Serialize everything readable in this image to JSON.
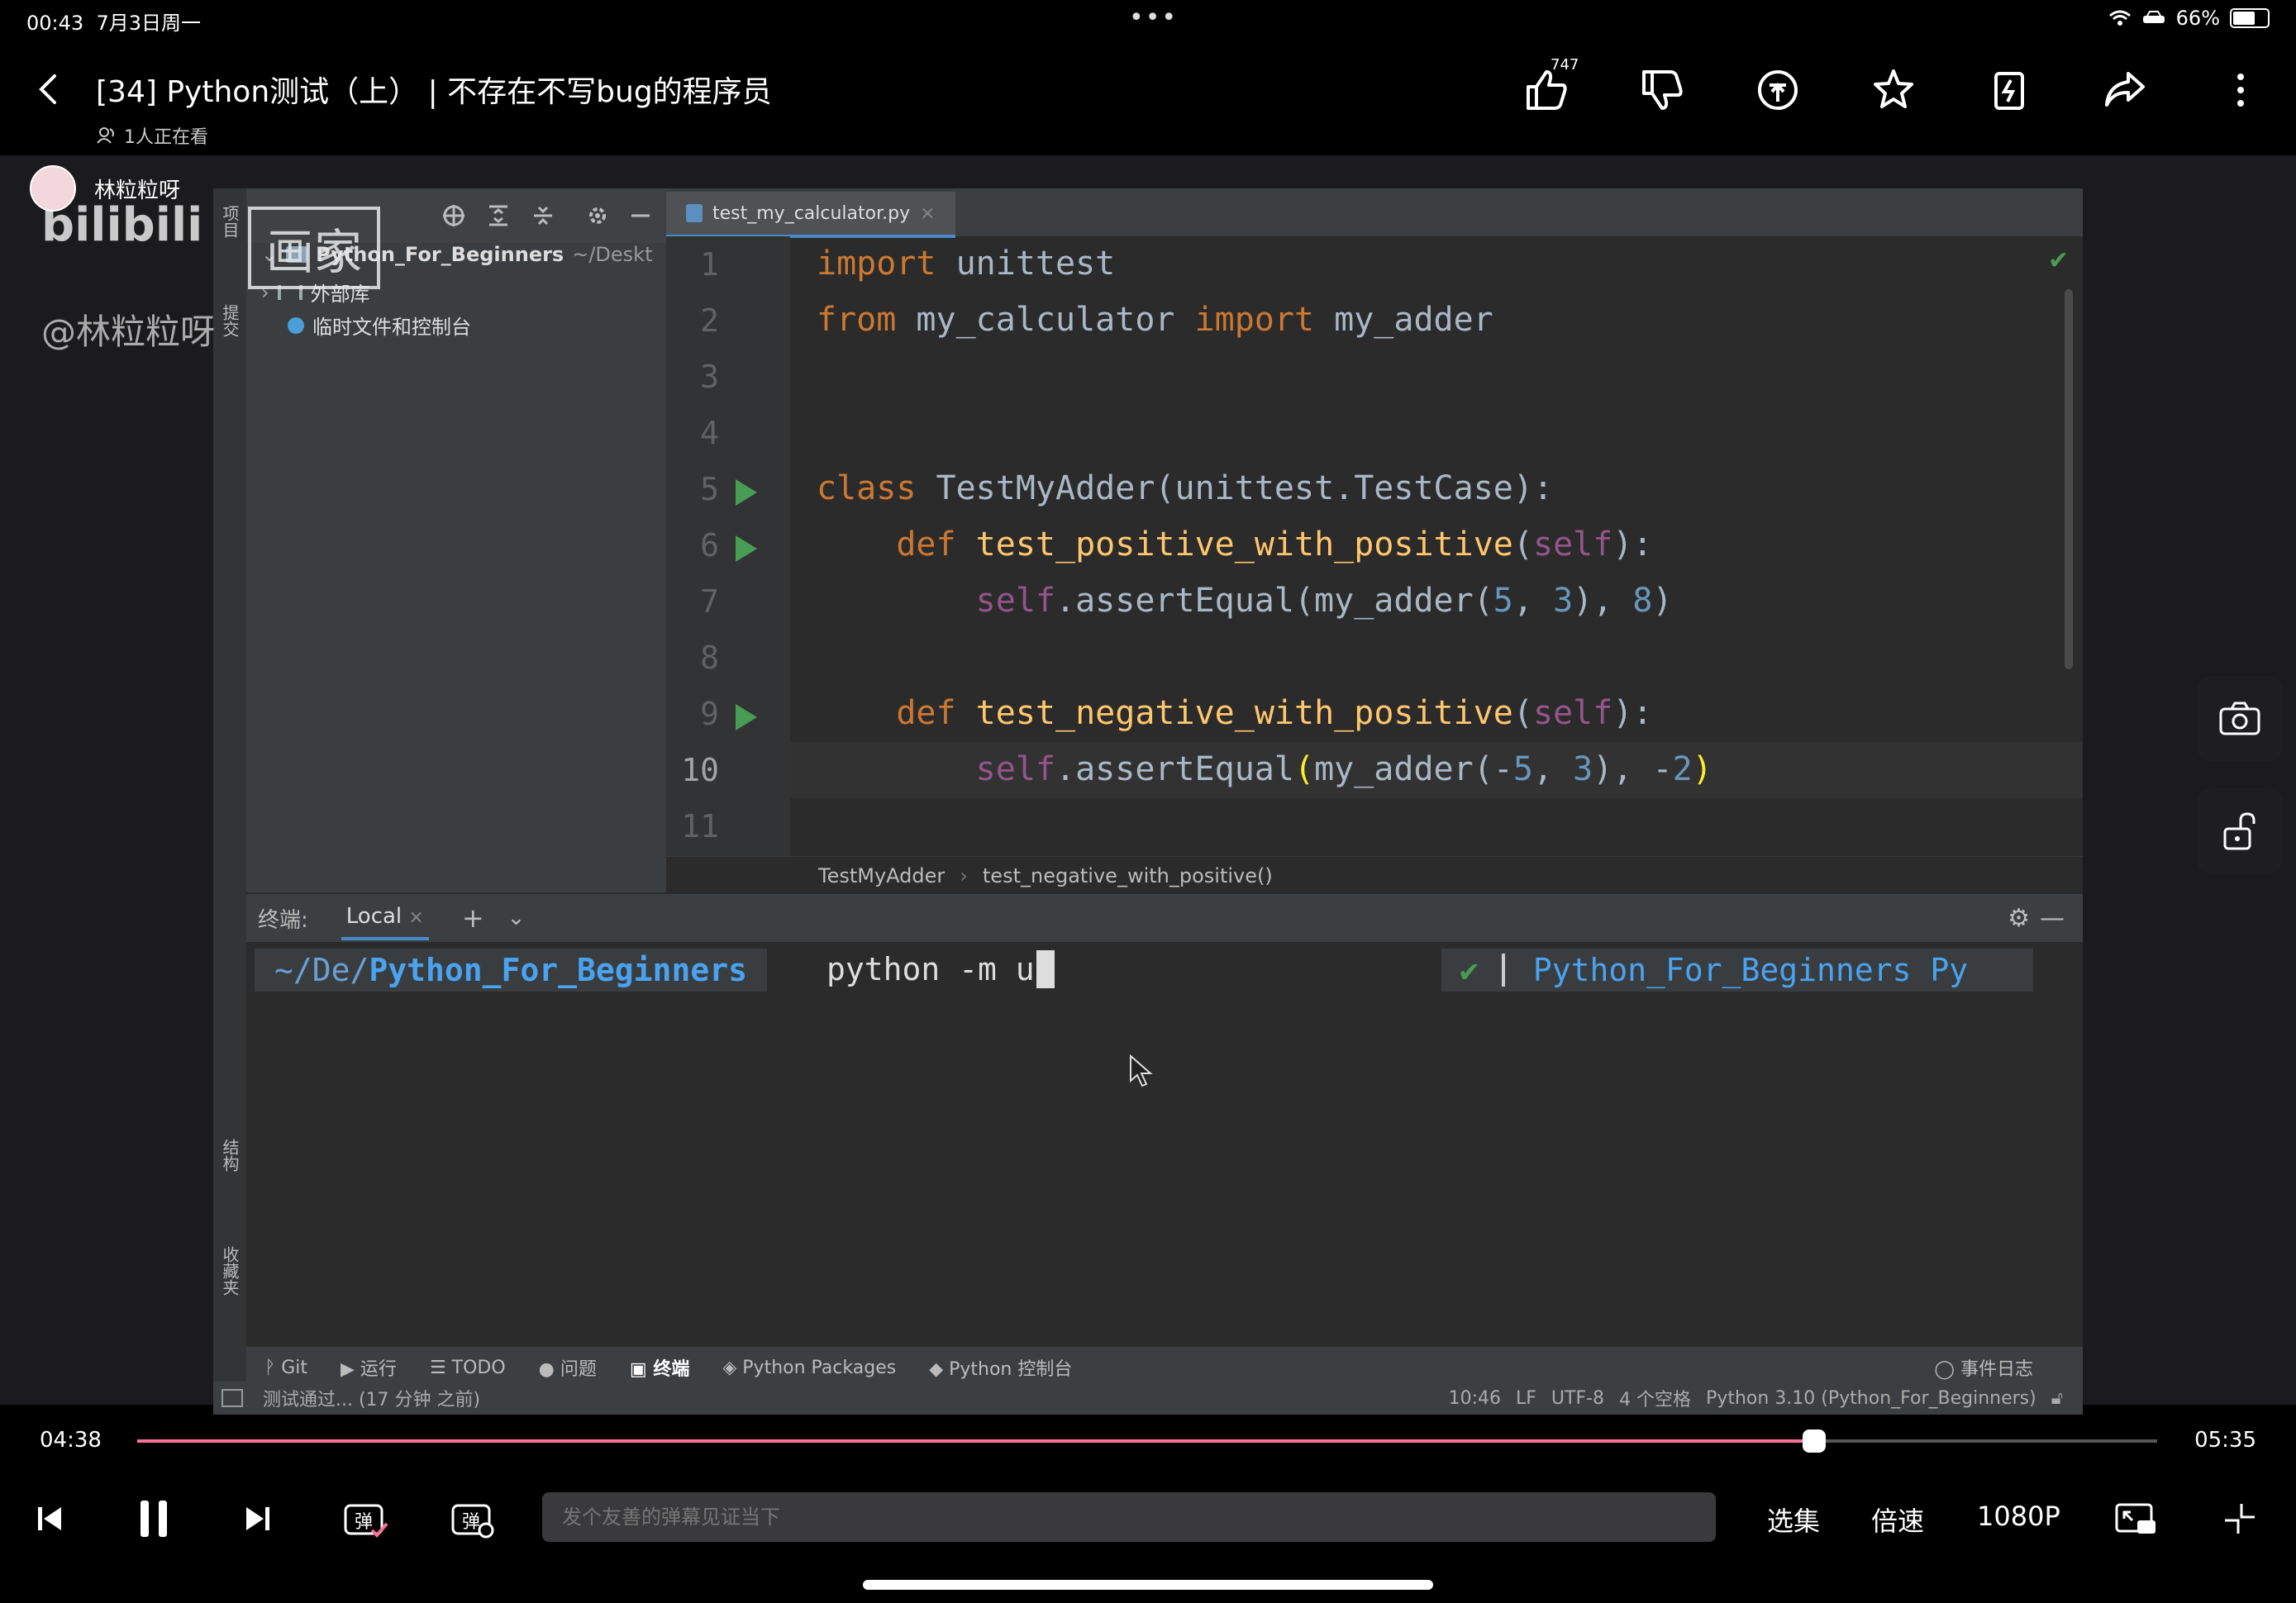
{
  "status_bar": {
    "time": "00:43",
    "date": "7月3日周一",
    "battery": "66%",
    "battery_level": 0.66
  },
  "header": {
    "title": "[34] Python测试（上） | 不存在不写bug的程序员",
    "viewers": "1人正在看",
    "like_count": "747",
    "icons": [
      "back-icon",
      "like-icon",
      "dislike-icon",
      "coin-icon",
      "favorite-icon",
      "charge-icon",
      "share-icon",
      "more-icon"
    ]
  },
  "uploader": {
    "name": "林粒粒呀"
  },
  "watermark": {
    "logo": "bilibili",
    "box": "画家",
    "handle": "@林粒粒呀"
  },
  "ide": {
    "left_strip_labels": [
      "项目",
      "提交",
      "结构",
      "收藏夹"
    ],
    "project_panel": {
      "root": "Python_For_Beginners",
      "root_path": "~/Deskt",
      "items": [
        "外部库",
        "临时文件和控制台"
      ]
    },
    "editor_tab": "test_my_calculator.py",
    "line_numbers": [
      "1",
      "2",
      "3",
      "4",
      "5",
      "6",
      "7",
      "8",
      "9",
      "10",
      "11"
    ],
    "breadcrumbs": [
      "TestMyAdder",
      "test_negative_with_positive()"
    ],
    "terminal": {
      "label": "终端:",
      "tab": "Local",
      "path_prefix": "~/De/",
      "path_dir": "Python_For_Beginners",
      "command": "python -m u",
      "right_env": "Python_For_Beginners Py"
    },
    "tool_windows": [
      "Git",
      "运行",
      "TODO",
      "问题",
      "终端",
      "Python Packages",
      "Python 控制台"
    ],
    "event_log": "事件日志",
    "status_message": "测试通过... (17 分钟 之前)",
    "status_right": [
      "10:46",
      "LF",
      "UTF-8",
      "4 个空格",
      "Python 3.10 (Python_For_Beginners)"
    ]
  },
  "player": {
    "current_time": "04:38",
    "total_time": "05:35",
    "progress": 0.83,
    "danmaku_placeholder": "发个友善的弹幕见证当下",
    "episodes_label": "选集",
    "speed_label": "倍速",
    "quality_label": "1080P"
  }
}
